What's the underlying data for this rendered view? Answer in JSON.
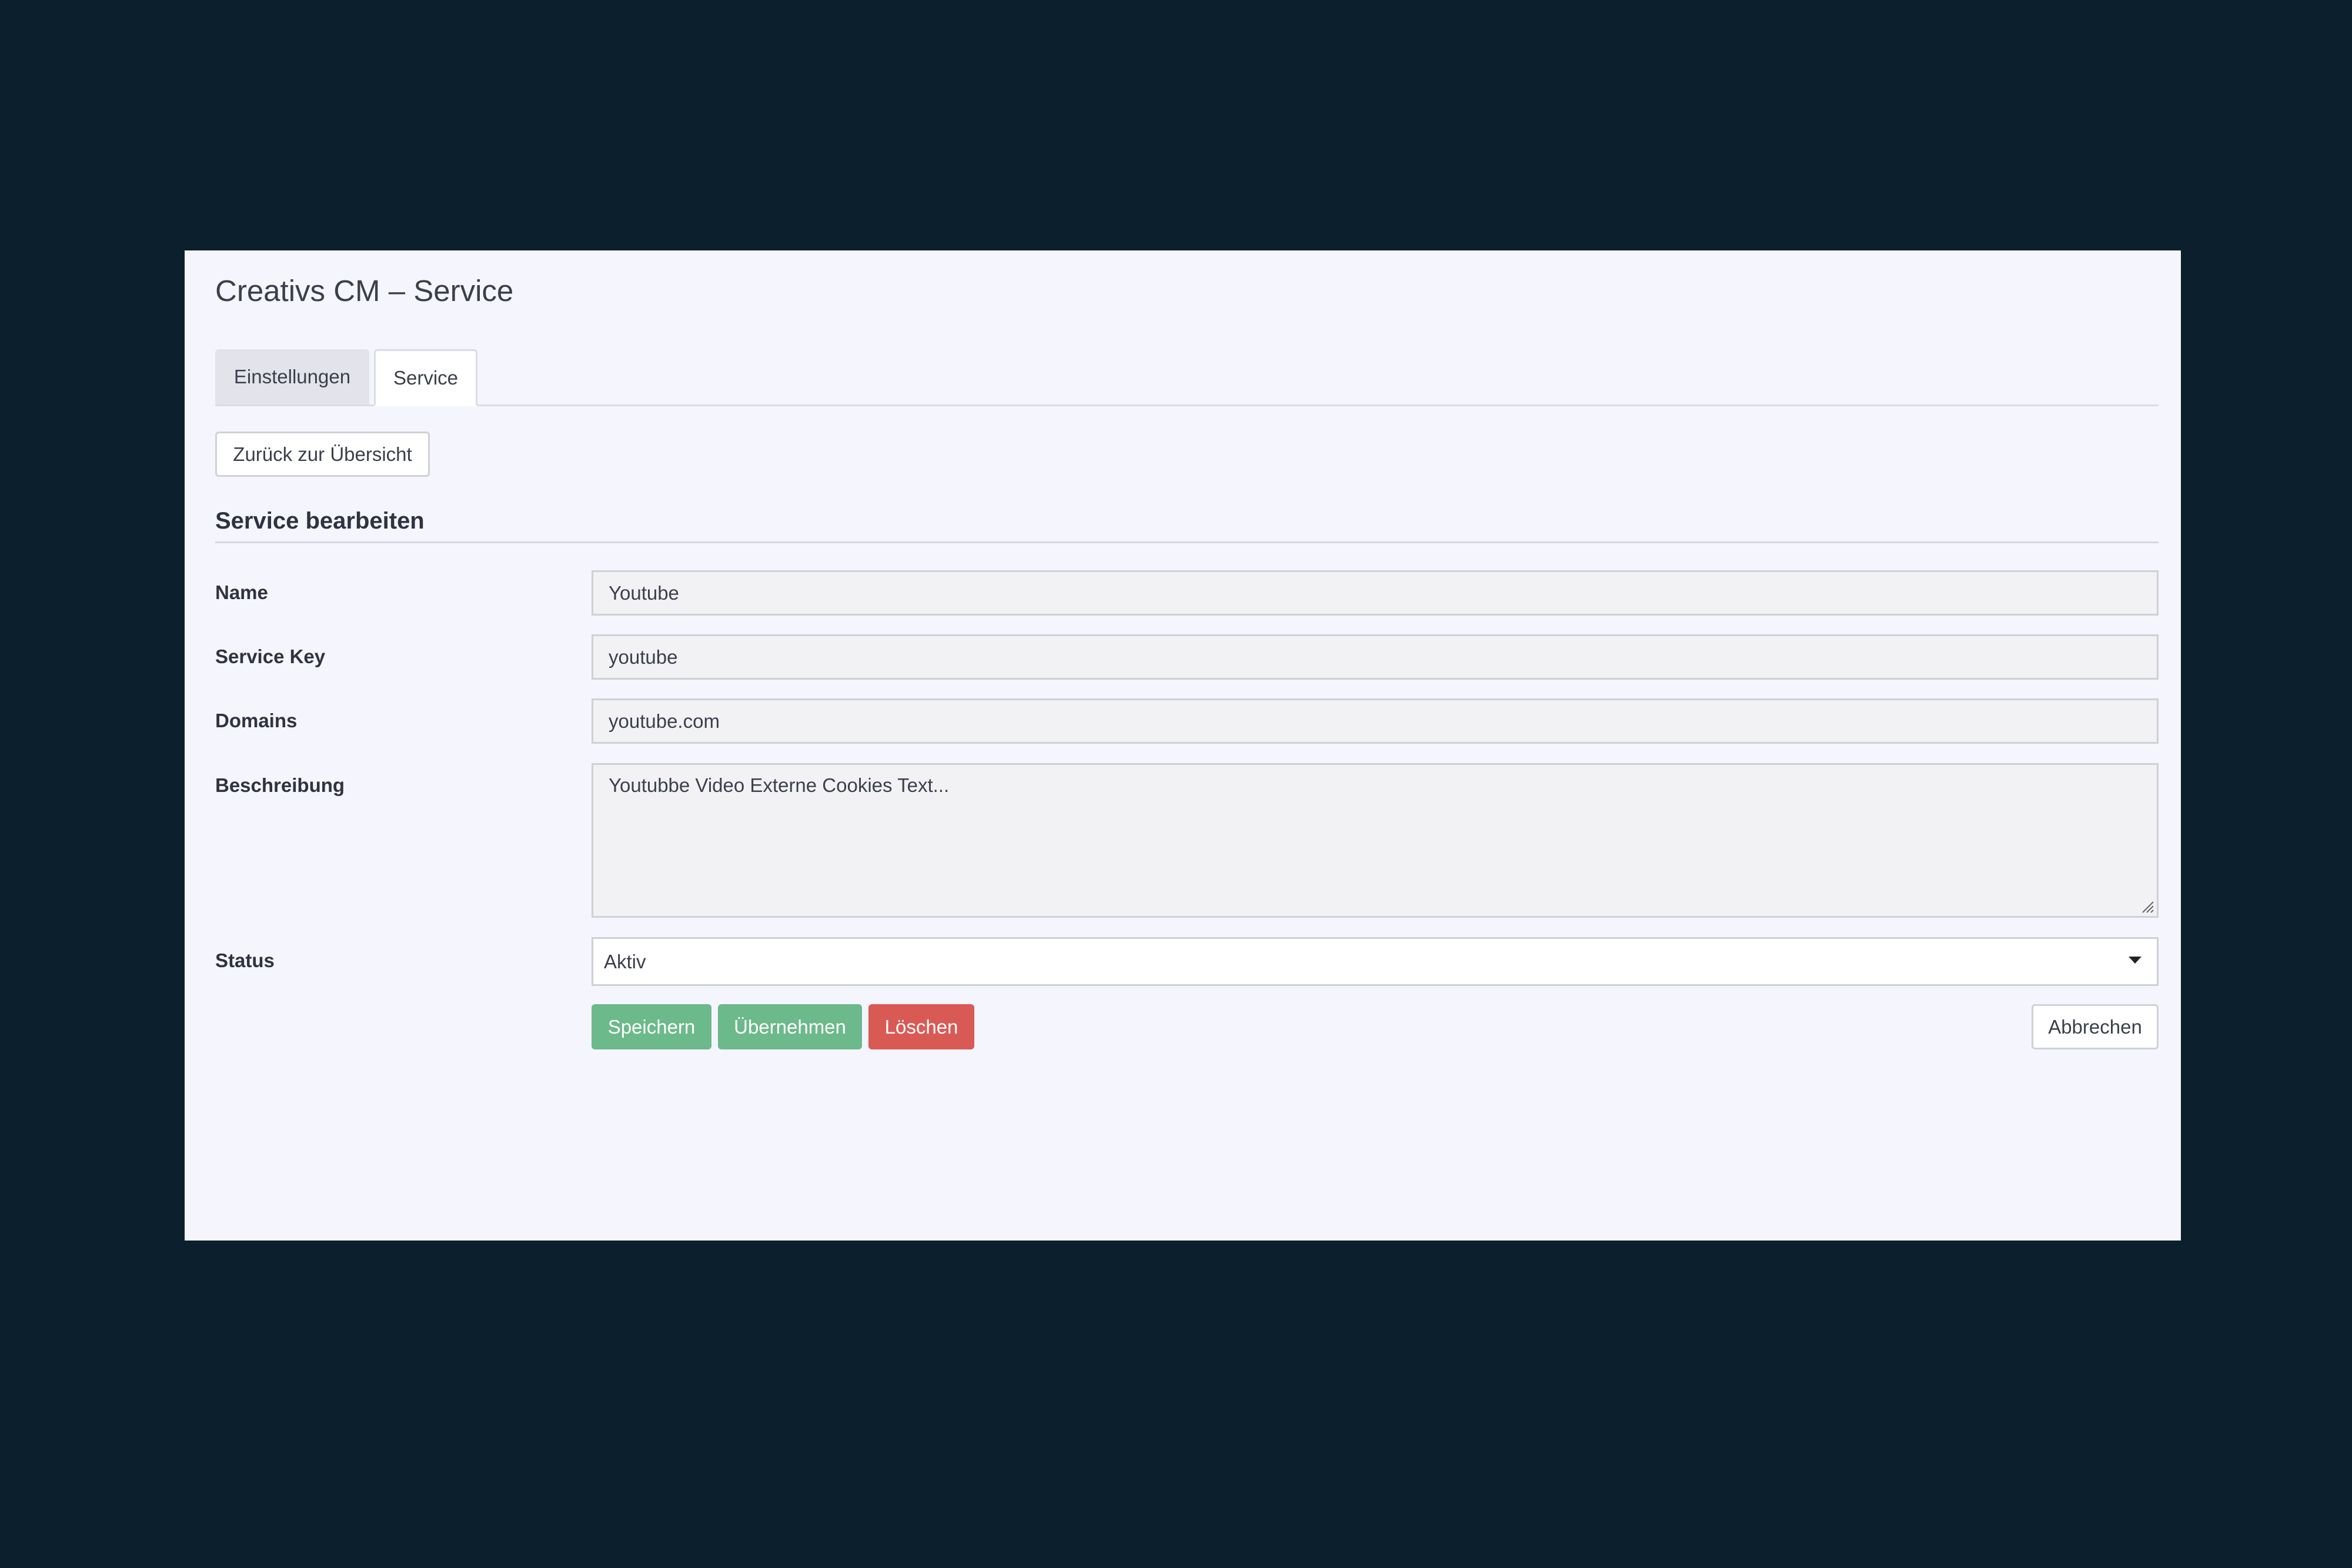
{
  "app": {
    "title": "Creativs CM – Service"
  },
  "tabs": [
    {
      "label": "Einstellungen",
      "active": false
    },
    {
      "label": "Service",
      "active": true
    }
  ],
  "navigation": {
    "back_label": "Zurück zur Übersicht"
  },
  "form": {
    "heading": "Service bearbeiten",
    "fields": {
      "name": {
        "label": "Name",
        "value": "Youtube"
      },
      "service_key": {
        "label": "Service Key",
        "value": "youtube"
      },
      "domains": {
        "label": "Domains",
        "value": "youtube.com"
      },
      "description": {
        "label": "Beschreibung",
        "value": "Youtubbe Video Externe Cookies Text..."
      },
      "status": {
        "label": "Status",
        "selected": "Aktiv"
      }
    }
  },
  "actions": {
    "save_label": "Speichern",
    "apply_label": "Übernehmen",
    "delete_label": "Löschen",
    "cancel_label": "Abbrechen"
  },
  "colors": {
    "page_background": "#0b1f2d",
    "panel_background": "#f5f5fd",
    "save_button": "#6cb98b",
    "apply_button": "#6cb98b",
    "delete_button": "#d95a54",
    "text": "#3b3f4c"
  },
  "icons": {
    "select_caret": "caret-down-icon",
    "textarea_resize": "resize-handle-icon"
  }
}
